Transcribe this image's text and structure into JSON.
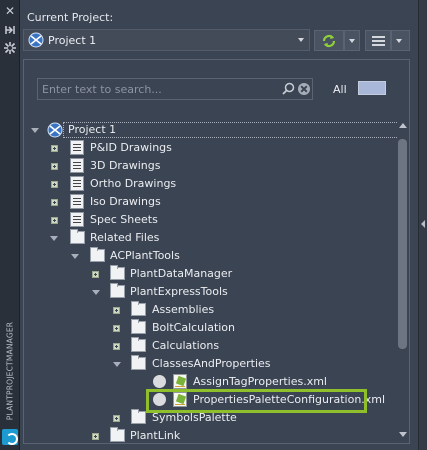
{
  "strip": {
    "title": "PLANTPROJECTMANAGER",
    "icons": [
      "close-icon",
      "pin-icon",
      "settings-icon"
    ]
  },
  "header": {
    "current_project_label": "Current Project:",
    "project_name": "Project 1"
  },
  "search": {
    "placeholder": "Enter text to search...",
    "value": "",
    "filter_label": "All"
  },
  "tree": {
    "rows": [
      {
        "label": "Project 1",
        "icon": "project-globe-icon",
        "expanded": true
      },
      {
        "label": "P&ID Drawings",
        "icon": "pid-drawings-icon"
      },
      {
        "label": "3D Drawings",
        "icon": "3d-drawings-icon"
      },
      {
        "label": "Ortho Drawings",
        "icon": "ortho-drawings-icon"
      },
      {
        "label": "Iso Drawings",
        "icon": "iso-drawings-icon"
      },
      {
        "label": "Spec Sheets",
        "icon": "spec-sheets-icon"
      },
      {
        "label": "Related Files",
        "icon": "folder-icon",
        "expanded": true
      },
      {
        "label": "ACPlantTools",
        "icon": "folder-icon",
        "expanded": true
      },
      {
        "label": "PlantDataManager",
        "icon": "folder-icon"
      },
      {
        "label": "PlantExpressTools",
        "icon": "folder-icon",
        "expanded": true
      },
      {
        "label": "Assemblies",
        "icon": "folder-icon"
      },
      {
        "label": "BoltCalculation",
        "icon": "folder-icon"
      },
      {
        "label": "Calculations",
        "icon": "folder-icon"
      },
      {
        "label": "ClassesAndProperties",
        "icon": "folder-icon",
        "expanded": true
      },
      {
        "label": "AssignTagProperties.xml",
        "icon": "xml-file-icon"
      },
      {
        "label": "PropertiesPaletteConfiguration.xml",
        "icon": "xml-file-icon",
        "highlighted": true
      },
      {
        "label": "SymbolsPalette",
        "icon": "folder-icon"
      },
      {
        "label": "PlantLink",
        "icon": "folder-icon"
      }
    ]
  },
  "colors": {
    "background": "#3b4453",
    "highlight": "#8fbf2a",
    "filter_swatch": "#a9b8d8"
  }
}
